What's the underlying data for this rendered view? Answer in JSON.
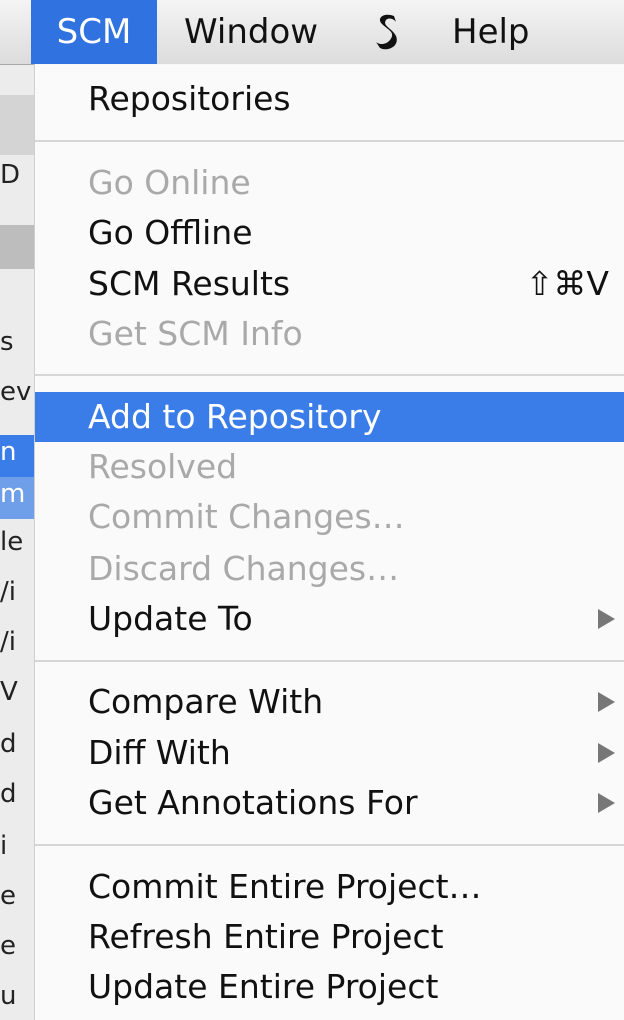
{
  "menubar": {
    "items": [
      {
        "label": "SCM"
      },
      {
        "label": "Window"
      },
      {
        "label": "Help"
      }
    ],
    "script_menu_icon": "script-s-icon"
  },
  "menu": {
    "title": "SCM",
    "items": [
      {
        "label": "Repositories",
        "enabled": true
      },
      {
        "label": "Go Online",
        "enabled": false
      },
      {
        "label": "Go Offline",
        "enabled": true
      },
      {
        "label": "SCM Results",
        "enabled": true,
        "shortcut": "⇧⌘V"
      },
      {
        "label": "Get SCM Info",
        "enabled": false
      },
      {
        "label": "Add to Repository",
        "enabled": true,
        "selected": true
      },
      {
        "label": "Resolved",
        "enabled": false
      },
      {
        "label": "Commit Changes…",
        "enabled": false
      },
      {
        "label": "Discard Changes…",
        "enabled": false
      },
      {
        "label": "Update To",
        "enabled": true,
        "submenu": true
      },
      {
        "label": "Compare With",
        "enabled": true,
        "submenu": true
      },
      {
        "label": "Diff With",
        "enabled": true,
        "submenu": true
      },
      {
        "label": "Get Annotations For",
        "enabled": true,
        "submenu": true
      },
      {
        "label": "Commit Entire Project…",
        "enabled": true
      },
      {
        "label": "Refresh Entire Project",
        "enabled": true
      },
      {
        "label": "Update Entire Project",
        "enabled": true
      }
    ]
  },
  "background_window": {
    "fragments": [
      "D",
      "s",
      "ev",
      "n",
      "m",
      "le",
      "/i",
      "/i",
      "V",
      "d",
      "d",
      "i",
      "e",
      "e",
      "u"
    ]
  },
  "colors": {
    "selection": "#3b7de8",
    "menubar_active": "#2f72e0",
    "disabled_text": "#a9a9a9"
  }
}
